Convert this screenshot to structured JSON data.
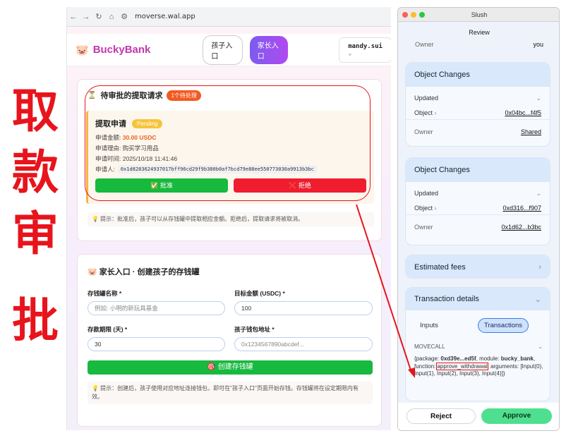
{
  "annotation": {
    "chars": [
      "取",
      "款",
      "审",
      "批"
    ]
  },
  "browser": {
    "url": "moverse.wal.app",
    "logo": "BuckyBank",
    "nav_kid": "孩子入口",
    "nav_parent": "家长入口",
    "account": "mandy.sui"
  },
  "pending": {
    "title": "待审批的提取请求",
    "count_badge": "1个待处理",
    "request_title": "提取申请",
    "status": "Pending",
    "amount_label": "申请金额:",
    "amount_value": "30.00 USDC",
    "reason": "申请理由: 购买学习用品",
    "time": "申请时间: 2025/10/18 11:41:46",
    "applicant_label": "申请人:",
    "applicant_addr": "0x1d8283624937017bff96cd29f9b380b0af7bcd79e88ee550773030a9913b3bc",
    "approve": "✅ 批准",
    "reject": "❌ 拒绝",
    "tip": "💡 提示：批准后，孩子可以从存钱罐中提取相应金额。拒绝后，提取请求将被取消。"
  },
  "create": {
    "title": "🐷 家长入口 · 创建孩子的存钱罐",
    "name_label": "存钱罐名称 *",
    "name_placeholder": "例如: 小明的新玩具基金",
    "target_label": "目标金额 (USDC) *",
    "target_value": "100",
    "period_label": "存款期限 (天) *",
    "period_value": "30",
    "address_label": "孩子钱包地址 *",
    "address_placeholder": "0x1234567890abcdef...",
    "create_button": "🎯 创建存钱罐",
    "tip": "💡 提示：创建后，孩子使用对应地址连接钱包，即可在\"孩子入口\"页面开始存钱。存钱罐将在设定期限内有效。"
  },
  "slush": {
    "window_title": "Slush",
    "review": "Review",
    "owner_top_label": "Owner",
    "owner_top_value": "you",
    "changes1": {
      "title": "Object Changes",
      "updated": "Updated",
      "object_label": "Object",
      "object_value": "0x04bc...f4f5",
      "owner_label": "Owner",
      "owner_value": "Shared"
    },
    "changes2": {
      "title": "Object Changes",
      "updated": "Updated",
      "object_label": "Object",
      "object_value": "0xd316...f907",
      "owner_label": "Owner",
      "owner_value": "0x1d62...b3bc"
    },
    "fees": "Estimated fees",
    "details": "Transaction details",
    "tab_inputs": "Inputs",
    "tab_transactions": "Transactions",
    "movecall": "MOVECALL",
    "code_prefix": "{package: ",
    "code_pkg": "0xd39e...ed5f",
    "code_module": ", module: ",
    "code_mod_val": "bucky_bank",
    "code_function": ", function: ",
    "code_fn_val": "approve_withdrawal",
    "code_args": ", arguments: [Input(0), Input(1), Input(2), Input(3), Input(4)]}",
    "reject": "Reject",
    "approve": "Approve"
  },
  "colors": {
    "accent_red": "#e8141c",
    "approve_green": "#17b93f",
    "wallet_green": "#4ee08f"
  }
}
